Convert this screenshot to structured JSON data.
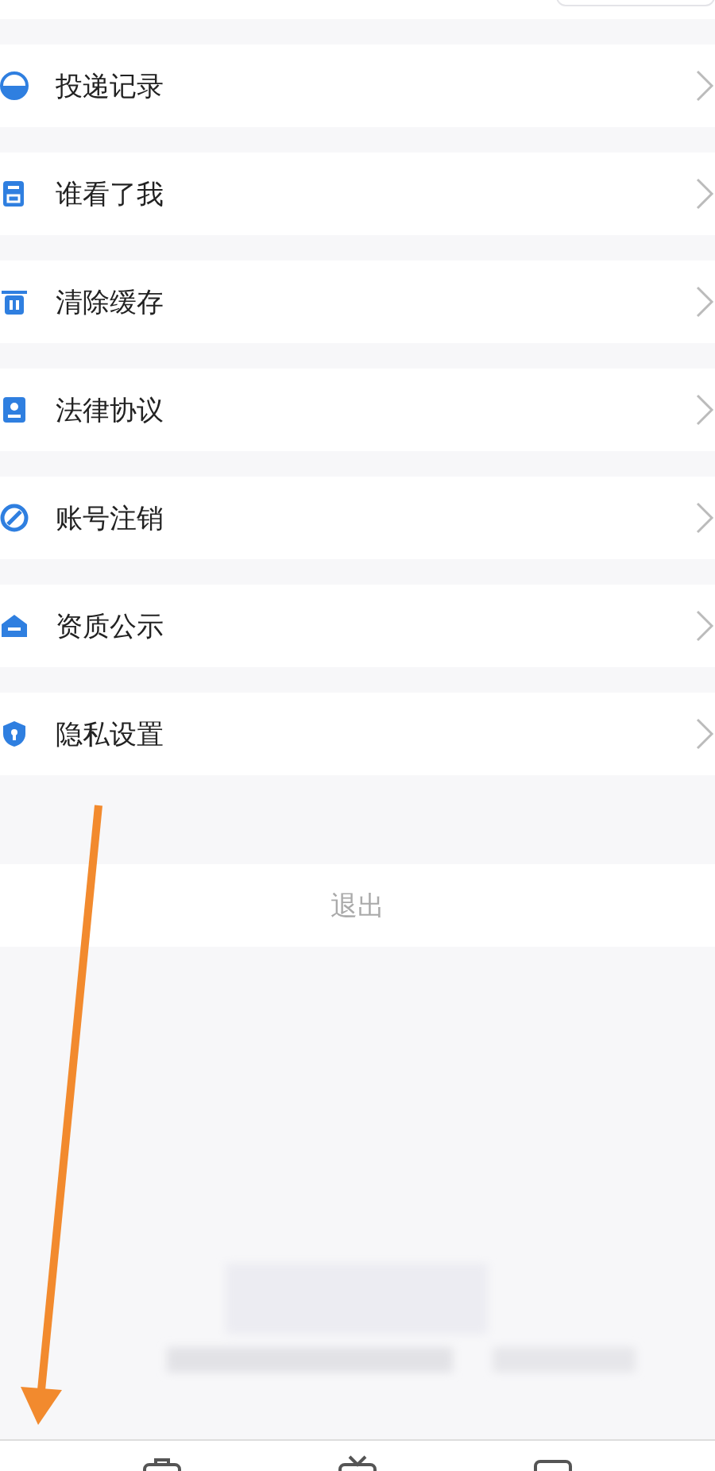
{
  "menu_items": [
    {
      "label": "投递记录"
    },
    {
      "label": "谁看了我"
    },
    {
      "label": "清除缓存"
    },
    {
      "label": "法律协议"
    },
    {
      "label": "账号注销"
    },
    {
      "label": "资质公示"
    },
    {
      "label": "隐私设置"
    }
  ],
  "logout_button": {
    "label": "退出"
  }
}
